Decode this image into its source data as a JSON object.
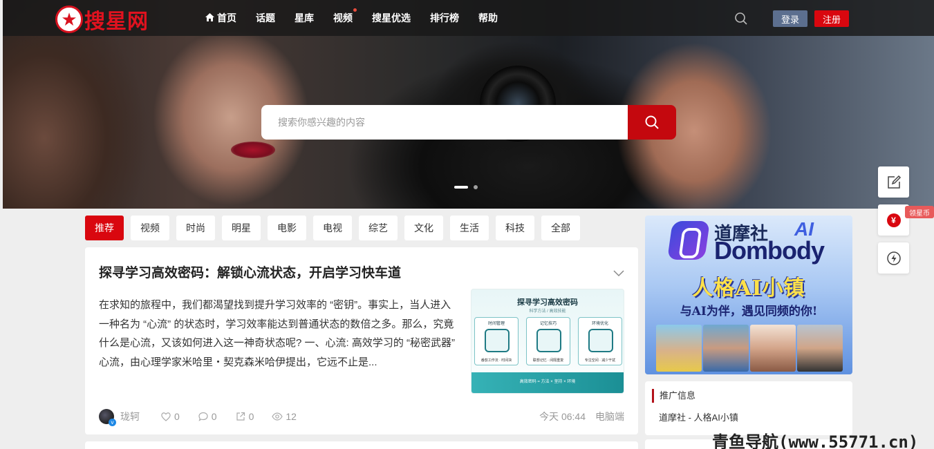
{
  "brand": {
    "logo_text": "搜星网",
    "logo_icon": "star-icon"
  },
  "nav": {
    "items": [
      {
        "label": "首页",
        "icon": "home-icon"
      },
      {
        "label": "话题"
      },
      {
        "label": "星库"
      },
      {
        "label": "视频",
        "has_dot": true
      },
      {
        "label": "搜星优选"
      },
      {
        "label": "排行榜"
      },
      {
        "label": "帮助"
      }
    ],
    "login_label": "登录",
    "register_label": "注册"
  },
  "hero_search": {
    "placeholder": "搜索你感兴趣的内容",
    "button_icon": "search-icon"
  },
  "carousel": {
    "total": 2,
    "active": 1
  },
  "category_tabs": [
    "推荐",
    "视频",
    "时尚",
    "明星",
    "电影",
    "电视",
    "综艺",
    "文化",
    "生活",
    "科技",
    "全部"
  ],
  "post": {
    "title": "探寻学习高效密码：解锁心流状态，开启学习快车道",
    "excerpt": "在求知的旅程中，我们都渴望找到提升学习效率的 “密钥”。事实上，当人进入一种名为 “心流” 的状态时，学习效率能达到普通状态的数倍之多。那么，究竟什么是心流，又该如何进入这一神奇状态呢? 一、心流: 高效学习的 “秘密武器” 心流，由心理学家米哈里・契克森米哈伊提出，它远不止是...",
    "thumbnail": {
      "title": "探寻学习高效密码",
      "subtitle": "科学方法 / 高效技能",
      "boxes": [
        {
          "label": "时间管理",
          "caption": "番茄工作法 · 时间块"
        },
        {
          "label": "记忆技巧",
          "caption": "联想记忆 · 间隔重复"
        },
        {
          "label": "环境优化",
          "caption": "专注空间 · 减少干扰"
        }
      ],
      "footer": "高效密码 = 方法 × 坚持 × 环境"
    },
    "author": "珑轲",
    "likes": "0",
    "comments": "0",
    "shares": "0",
    "views": "12",
    "time": "今天 06:44",
    "source": "电脑端"
  },
  "sidebar": {
    "ad": {
      "brand_cn": "道摩社",
      "brand_ai": "AI",
      "brand_en": "Dombody",
      "headline": "人格AI小镇",
      "tagline": "与AI为伴，遇见同频的你!"
    },
    "promo": {
      "heading": "推广信息",
      "link": "道摩社 - 人格AI小镇"
    }
  },
  "float_tools": {
    "coin_symbol": "¥",
    "coin_badge": "领星币"
  },
  "watermark": "青鱼导航(www.55771.cn)",
  "colors": {
    "accent": "#d9070f",
    "login": "#5c6f8f"
  }
}
